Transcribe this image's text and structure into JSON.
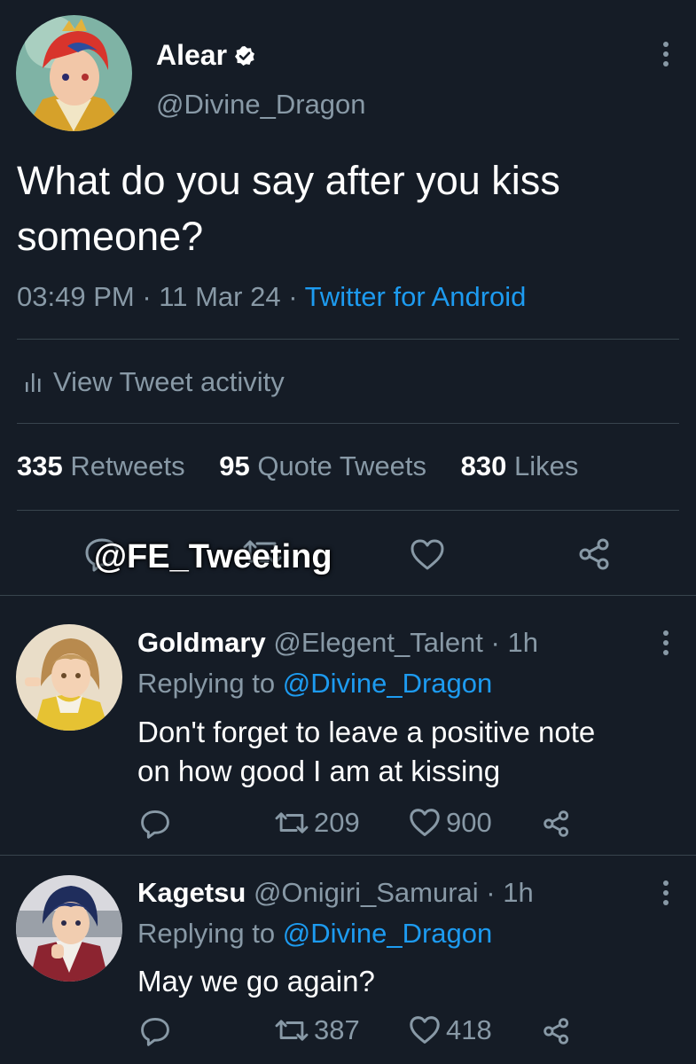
{
  "main_tweet": {
    "display_name": "Alear",
    "handle": "@Divine_Dragon",
    "text_line1": "What do you say after you kiss",
    "text_line2": "someone?",
    "time": "03:49 PM",
    "date": "11 Mar 24",
    "source": "Twitter for Android",
    "activity_label": "View Tweet activity",
    "stats": {
      "retweets_count": "335",
      "retweets_label": "Retweets",
      "quotes_count": "95",
      "quotes_label": "Quote Tweets",
      "likes_count": "830",
      "likes_label": "Likes"
    },
    "watermark": "@FE_Tweeting"
  },
  "replies": [
    {
      "display_name": "Goldmary",
      "handle": "@Elegent_Talent",
      "time": "1h",
      "replying_prefix": "Replying to",
      "replying_to": "@Divine_Dragon",
      "text_line1": "Don't forget to leave a positive note",
      "text_line2": "on how good I am at kissing",
      "retweets": "209",
      "likes": "900"
    },
    {
      "display_name": "Kagetsu",
      "handle": "@Onigiri_Samurai",
      "time": "1h",
      "replying_prefix": "Replying to",
      "replying_to": "@Divine_Dragon",
      "text_line1": "May we go again?",
      "retweets": "387",
      "likes": "418"
    }
  ],
  "icons": {
    "verified": "verified-badge-icon",
    "more": "more-options-icon",
    "activity": "bar-chart-icon",
    "reply": "reply-icon",
    "retweet": "retweet-icon",
    "like": "heart-icon",
    "share": "share-icon"
  },
  "colors": {
    "background": "#151c26",
    "text": "#ffffff",
    "muted": "#8899a6",
    "link": "#1d9bf0",
    "divider": "#38444d"
  }
}
